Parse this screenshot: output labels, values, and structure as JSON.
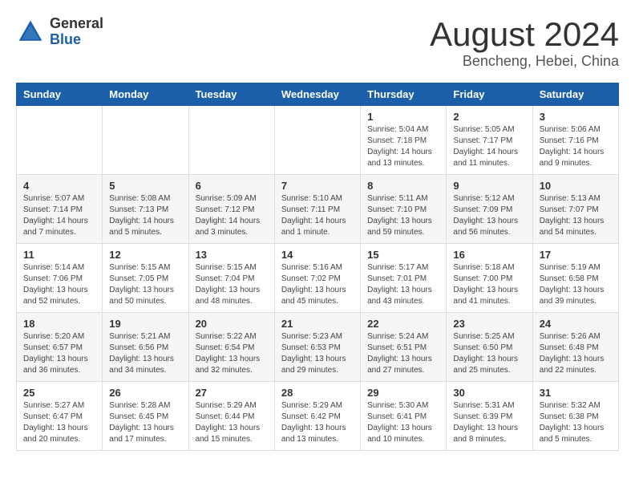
{
  "logo": {
    "general": "General",
    "blue": "Blue"
  },
  "title": "August 2024",
  "subtitle": "Bencheng, Hebei, China",
  "weekdays": [
    "Sunday",
    "Monday",
    "Tuesday",
    "Wednesday",
    "Thursday",
    "Friday",
    "Saturday"
  ],
  "weeks": [
    [
      {
        "day": "",
        "info": ""
      },
      {
        "day": "",
        "info": ""
      },
      {
        "day": "",
        "info": ""
      },
      {
        "day": "",
        "info": ""
      },
      {
        "day": "1",
        "info": "Sunrise: 5:04 AM\nSunset: 7:18 PM\nDaylight: 14 hours\nand 13 minutes."
      },
      {
        "day": "2",
        "info": "Sunrise: 5:05 AM\nSunset: 7:17 PM\nDaylight: 14 hours\nand 11 minutes."
      },
      {
        "day": "3",
        "info": "Sunrise: 5:06 AM\nSunset: 7:16 PM\nDaylight: 14 hours\nand 9 minutes."
      }
    ],
    [
      {
        "day": "4",
        "info": "Sunrise: 5:07 AM\nSunset: 7:14 PM\nDaylight: 14 hours\nand 7 minutes."
      },
      {
        "day": "5",
        "info": "Sunrise: 5:08 AM\nSunset: 7:13 PM\nDaylight: 14 hours\nand 5 minutes."
      },
      {
        "day": "6",
        "info": "Sunrise: 5:09 AM\nSunset: 7:12 PM\nDaylight: 14 hours\nand 3 minutes."
      },
      {
        "day": "7",
        "info": "Sunrise: 5:10 AM\nSunset: 7:11 PM\nDaylight: 14 hours\nand 1 minute."
      },
      {
        "day": "8",
        "info": "Sunrise: 5:11 AM\nSunset: 7:10 PM\nDaylight: 13 hours\nand 59 minutes."
      },
      {
        "day": "9",
        "info": "Sunrise: 5:12 AM\nSunset: 7:09 PM\nDaylight: 13 hours\nand 56 minutes."
      },
      {
        "day": "10",
        "info": "Sunrise: 5:13 AM\nSunset: 7:07 PM\nDaylight: 13 hours\nand 54 minutes."
      }
    ],
    [
      {
        "day": "11",
        "info": "Sunrise: 5:14 AM\nSunset: 7:06 PM\nDaylight: 13 hours\nand 52 minutes."
      },
      {
        "day": "12",
        "info": "Sunrise: 5:15 AM\nSunset: 7:05 PM\nDaylight: 13 hours\nand 50 minutes."
      },
      {
        "day": "13",
        "info": "Sunrise: 5:15 AM\nSunset: 7:04 PM\nDaylight: 13 hours\nand 48 minutes."
      },
      {
        "day": "14",
        "info": "Sunrise: 5:16 AM\nSunset: 7:02 PM\nDaylight: 13 hours\nand 45 minutes."
      },
      {
        "day": "15",
        "info": "Sunrise: 5:17 AM\nSunset: 7:01 PM\nDaylight: 13 hours\nand 43 minutes."
      },
      {
        "day": "16",
        "info": "Sunrise: 5:18 AM\nSunset: 7:00 PM\nDaylight: 13 hours\nand 41 minutes."
      },
      {
        "day": "17",
        "info": "Sunrise: 5:19 AM\nSunset: 6:58 PM\nDaylight: 13 hours\nand 39 minutes."
      }
    ],
    [
      {
        "day": "18",
        "info": "Sunrise: 5:20 AM\nSunset: 6:57 PM\nDaylight: 13 hours\nand 36 minutes."
      },
      {
        "day": "19",
        "info": "Sunrise: 5:21 AM\nSunset: 6:56 PM\nDaylight: 13 hours\nand 34 minutes."
      },
      {
        "day": "20",
        "info": "Sunrise: 5:22 AM\nSunset: 6:54 PM\nDaylight: 13 hours\nand 32 minutes."
      },
      {
        "day": "21",
        "info": "Sunrise: 5:23 AM\nSunset: 6:53 PM\nDaylight: 13 hours\nand 29 minutes."
      },
      {
        "day": "22",
        "info": "Sunrise: 5:24 AM\nSunset: 6:51 PM\nDaylight: 13 hours\nand 27 minutes."
      },
      {
        "day": "23",
        "info": "Sunrise: 5:25 AM\nSunset: 6:50 PM\nDaylight: 13 hours\nand 25 minutes."
      },
      {
        "day": "24",
        "info": "Sunrise: 5:26 AM\nSunset: 6:48 PM\nDaylight: 13 hours\nand 22 minutes."
      }
    ],
    [
      {
        "day": "25",
        "info": "Sunrise: 5:27 AM\nSunset: 6:47 PM\nDaylight: 13 hours\nand 20 minutes."
      },
      {
        "day": "26",
        "info": "Sunrise: 5:28 AM\nSunset: 6:45 PM\nDaylight: 13 hours\nand 17 minutes."
      },
      {
        "day": "27",
        "info": "Sunrise: 5:29 AM\nSunset: 6:44 PM\nDaylight: 13 hours\nand 15 minutes."
      },
      {
        "day": "28",
        "info": "Sunrise: 5:29 AM\nSunset: 6:42 PM\nDaylight: 13 hours\nand 13 minutes."
      },
      {
        "day": "29",
        "info": "Sunrise: 5:30 AM\nSunset: 6:41 PM\nDaylight: 13 hours\nand 10 minutes."
      },
      {
        "day": "30",
        "info": "Sunrise: 5:31 AM\nSunset: 6:39 PM\nDaylight: 13 hours\nand 8 minutes."
      },
      {
        "day": "31",
        "info": "Sunrise: 5:32 AM\nSunset: 6:38 PM\nDaylight: 13 hours\nand 5 minutes."
      }
    ]
  ]
}
